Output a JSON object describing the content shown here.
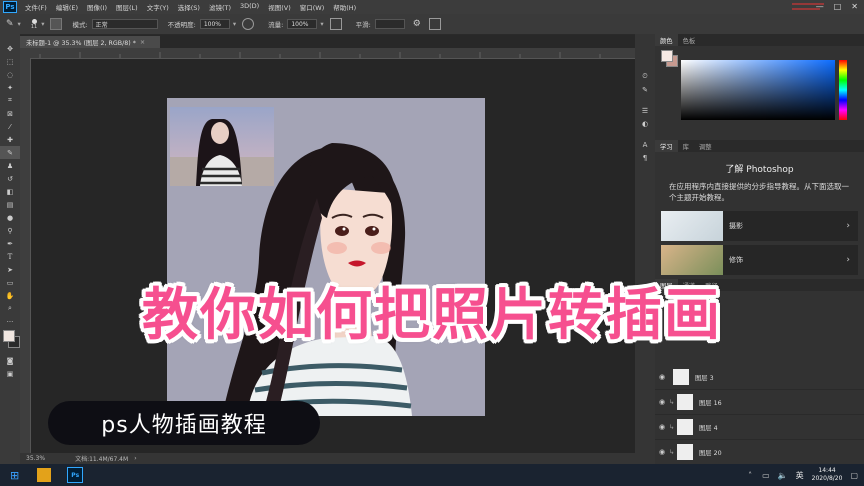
{
  "app": {
    "logo": "Ps",
    "menu": [
      "文件(F)",
      "编辑(E)",
      "图像(I)",
      "图层(L)",
      "文字(Y)",
      "选择(S)",
      "滤镜(T)",
      "3D(D)",
      "视图(V)",
      "窗口(W)",
      "帮助(H)"
    ],
    "window_controls": [
      "—",
      "□",
      "✕"
    ]
  },
  "options": {
    "brush_size": "11",
    "mode_label": "模式:",
    "mode_value": "正常",
    "opacity_label": "不透明度:",
    "opacity_value": "100%",
    "flow_label": "流量:",
    "flow_value": "100%",
    "smooth_label": "平滑:"
  },
  "document": {
    "tab_title": "未标题-1 @ 35.3% (图层 2, RGB/8) *",
    "tab_close": "×",
    "zoom": "35.3%",
    "doc_info": "文档:11.4M/67.4M",
    "status_arrow": "›"
  },
  "panels": {
    "color_tabs": [
      "颜色",
      "色板"
    ],
    "learn_tabs": [
      "学习",
      "库",
      "调整"
    ],
    "learn_title": "了解 Photoshop",
    "learn_desc": "在应用程序内直接提供的分步指导教程。从下面选取一个主题开始教程。",
    "learn_cards": [
      {
        "label": "摄影"
      },
      {
        "label": "修饰"
      }
    ],
    "layer_tabs": [
      "图层",
      "通道",
      "路径"
    ],
    "layers": [
      {
        "name": "图层 3"
      },
      {
        "name": "图层 16"
      },
      {
        "name": "图层 4"
      },
      {
        "name": "图层 20"
      }
    ]
  },
  "taskbar": {
    "time": "14:44",
    "date": "2020/8/20",
    "ime": "英"
  },
  "overlay": {
    "title": "教你如何把照片转插画",
    "subtitle": "ps人物插画教程"
  },
  "colors": {
    "accent_pink": "#f64f8f",
    "ps_blue": "#31a8ff",
    "canvas_bg": "#a4a4b6"
  }
}
